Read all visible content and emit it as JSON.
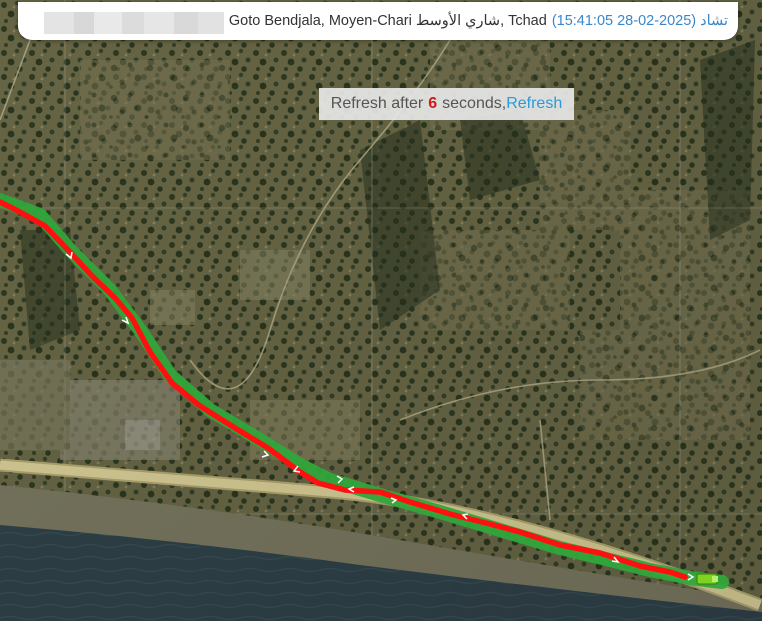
{
  "location": {
    "address_prefix": "Goto Bendjala, Moyen-Chari ",
    "address_arabic": "شاري الأوسط",
    "address_suffix": ", Tchad ",
    "timestamp": "(15:41:05 28-02-2025) تشاد"
  },
  "refresh": {
    "prefix": "Refresh after",
    "seconds": "6",
    "suffix": "seconds,",
    "link_label": "Refresh"
  },
  "colors": {
    "track_red": "#ff1010",
    "track_green": "#2fa63a",
    "road": "#d9cf95",
    "river": "#31444a",
    "vehicle": "#8ee03a",
    "link": "#2a9ad8",
    "countdown": "#d21a1a"
  },
  "map": {
    "type": "satellite",
    "icons": [
      "direction-arrow-icon",
      "vehicle-marker-icon"
    ]
  }
}
